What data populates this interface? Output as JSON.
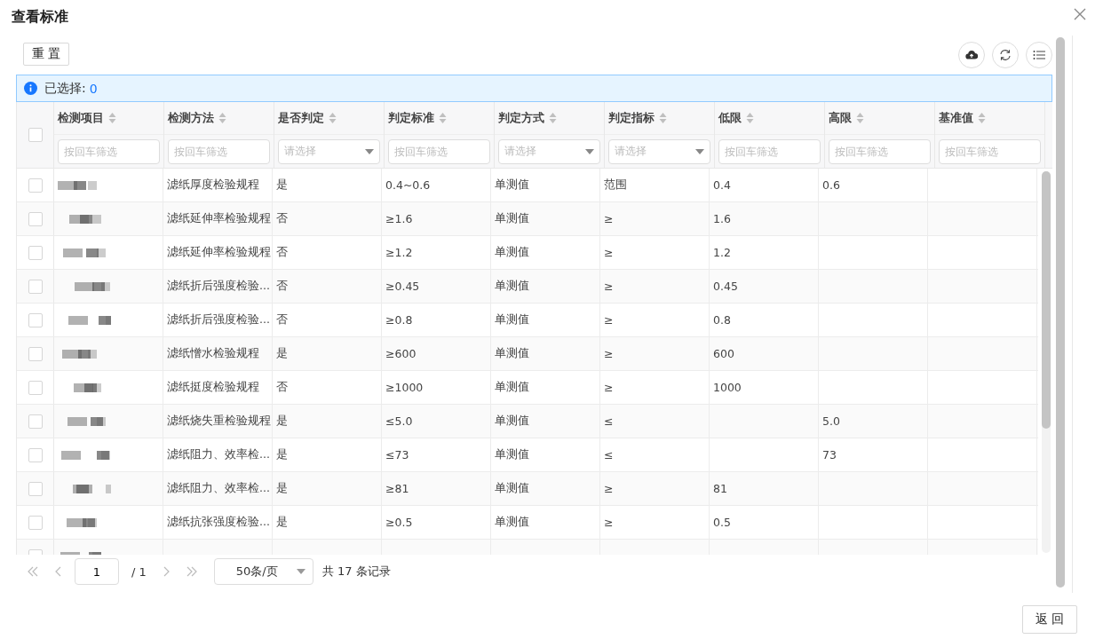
{
  "dialog": {
    "title": "查看标准"
  },
  "toolbar": {
    "reset_button": "重 置"
  },
  "selection_bar": {
    "label": "已选择:",
    "count": "0"
  },
  "table": {
    "header_checked": false,
    "columns": [
      {
        "label": "检测项目",
        "filter": {
          "kind": "text",
          "placeholder": "按回车筛选"
        }
      },
      {
        "label": "检测方法",
        "filter": {
          "kind": "text",
          "placeholder": "按回车筛选"
        }
      },
      {
        "label": "是否判定",
        "filter": {
          "kind": "select",
          "placeholder": "请选择"
        }
      },
      {
        "label": "判定标准",
        "filter": {
          "kind": "text",
          "placeholder": "按回车筛选"
        }
      },
      {
        "label": "判定方式",
        "filter": {
          "kind": "select",
          "placeholder": "请选择"
        }
      },
      {
        "label": "判定指标",
        "filter": {
          "kind": "select",
          "placeholder": "请选择"
        }
      },
      {
        "label": "低限",
        "filter": {
          "kind": "text",
          "placeholder": "按回车筛选"
        }
      },
      {
        "label": "高限",
        "filter": {
          "kind": "text",
          "placeholder": "按回车筛选"
        }
      },
      {
        "label": "基准值",
        "filter": {
          "kind": "text",
          "placeholder": "按回车筛选"
        }
      }
    ],
    "rows": [
      {
        "checked": false,
        "method": "滤纸厚度检验规程",
        "judged": "是",
        "standard": "0.4~0.6",
        "mode": "单测值",
        "indicator": "范围",
        "low": "0.4",
        "high": "0.6"
      },
      {
        "checked": false,
        "method": "滤纸延伸率检验规程",
        "judged": "否",
        "standard": "≥1.6",
        "mode": "单测值",
        "indicator": "≥",
        "low": "1.6"
      },
      {
        "checked": false,
        "method": "滤纸延伸率检验规程",
        "judged": "否",
        "standard": "≥1.2",
        "mode": "单测值",
        "indicator": "≥",
        "low": "1.2"
      },
      {
        "checked": false,
        "method": "滤纸折后强度检验...",
        "judged": "否",
        "standard": "≥0.45",
        "mode": "单测值",
        "indicator": "≥",
        "low": "0.45"
      },
      {
        "checked": false,
        "method": "滤纸折后强度检验...",
        "judged": "否",
        "standard": "≥0.8",
        "mode": "单测值",
        "indicator": "≥",
        "low": "0.8"
      },
      {
        "checked": false,
        "method": "滤纸憎水检验规程",
        "judged": "是",
        "standard": "≥600",
        "mode": "单测值",
        "indicator": "≥",
        "low": "600"
      },
      {
        "checked": false,
        "method": "滤纸挺度检验规程",
        "judged": "否",
        "standard": "≥1000",
        "mode": "单测值",
        "indicator": "≥",
        "low": "1000"
      },
      {
        "checked": false,
        "method": "滤纸烧失重检验规程",
        "judged": "是",
        "standard": "≤5.0",
        "mode": "单测值",
        "indicator": "≤",
        "high": "5.0"
      },
      {
        "checked": false,
        "method": "滤纸阻力、效率检...",
        "judged": "是",
        "standard": "≤73",
        "mode": "单测值",
        "indicator": "≤",
        "high": "73"
      },
      {
        "checked": false,
        "method": "滤纸阻力、效率检...",
        "judged": "是",
        "standard": "≥81",
        "mode": "单测值",
        "indicator": "≥",
        "low": "81"
      },
      {
        "checked": false,
        "method": "滤纸抗张强度检验...",
        "judged": "是",
        "standard": "≥0.5",
        "mode": "单测值",
        "indicator": "≥",
        "low": "0.5"
      },
      {
        "checked": false
      }
    ]
  },
  "pagination": {
    "page": "1",
    "total_pages": "/ 1",
    "page_size": "50条/页",
    "total": "共 17 条记录"
  },
  "footer": {
    "back_button": "返 回"
  }
}
